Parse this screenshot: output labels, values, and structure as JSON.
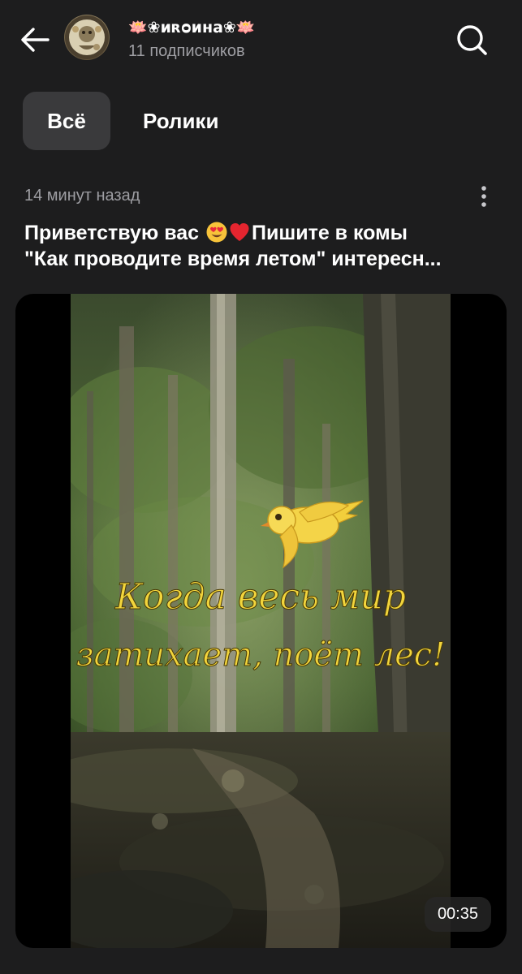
{
  "header": {
    "back_icon": "arrow-left-icon",
    "channel_name": "🪷❀иʀᴑина❀🪷",
    "subscribers": "11 подписчиков",
    "search_icon": "search-icon"
  },
  "tabs": [
    {
      "label": "Всё",
      "active": true
    },
    {
      "label": "Ролики",
      "active": false
    }
  ],
  "post": {
    "time": "14 минут назад",
    "menu_icon": "more-vertical-icon",
    "title_line1_a": "Приветствую вас ",
    "title_line1_b": "Пишите в комы",
    "title_line2": "\"Как проводите время летом\" интересн...",
    "video": {
      "overlay_line1": "Когда весь мир",
      "overlay_line2": "затихает, поёт лес!",
      "duration": "00:35"
    }
  },
  "colors": {
    "background": "#1d1d1e",
    "tab_active_bg": "#3a3a3c",
    "secondary_text": "#9e9ea3",
    "overlay_text": "#f2d53c"
  }
}
